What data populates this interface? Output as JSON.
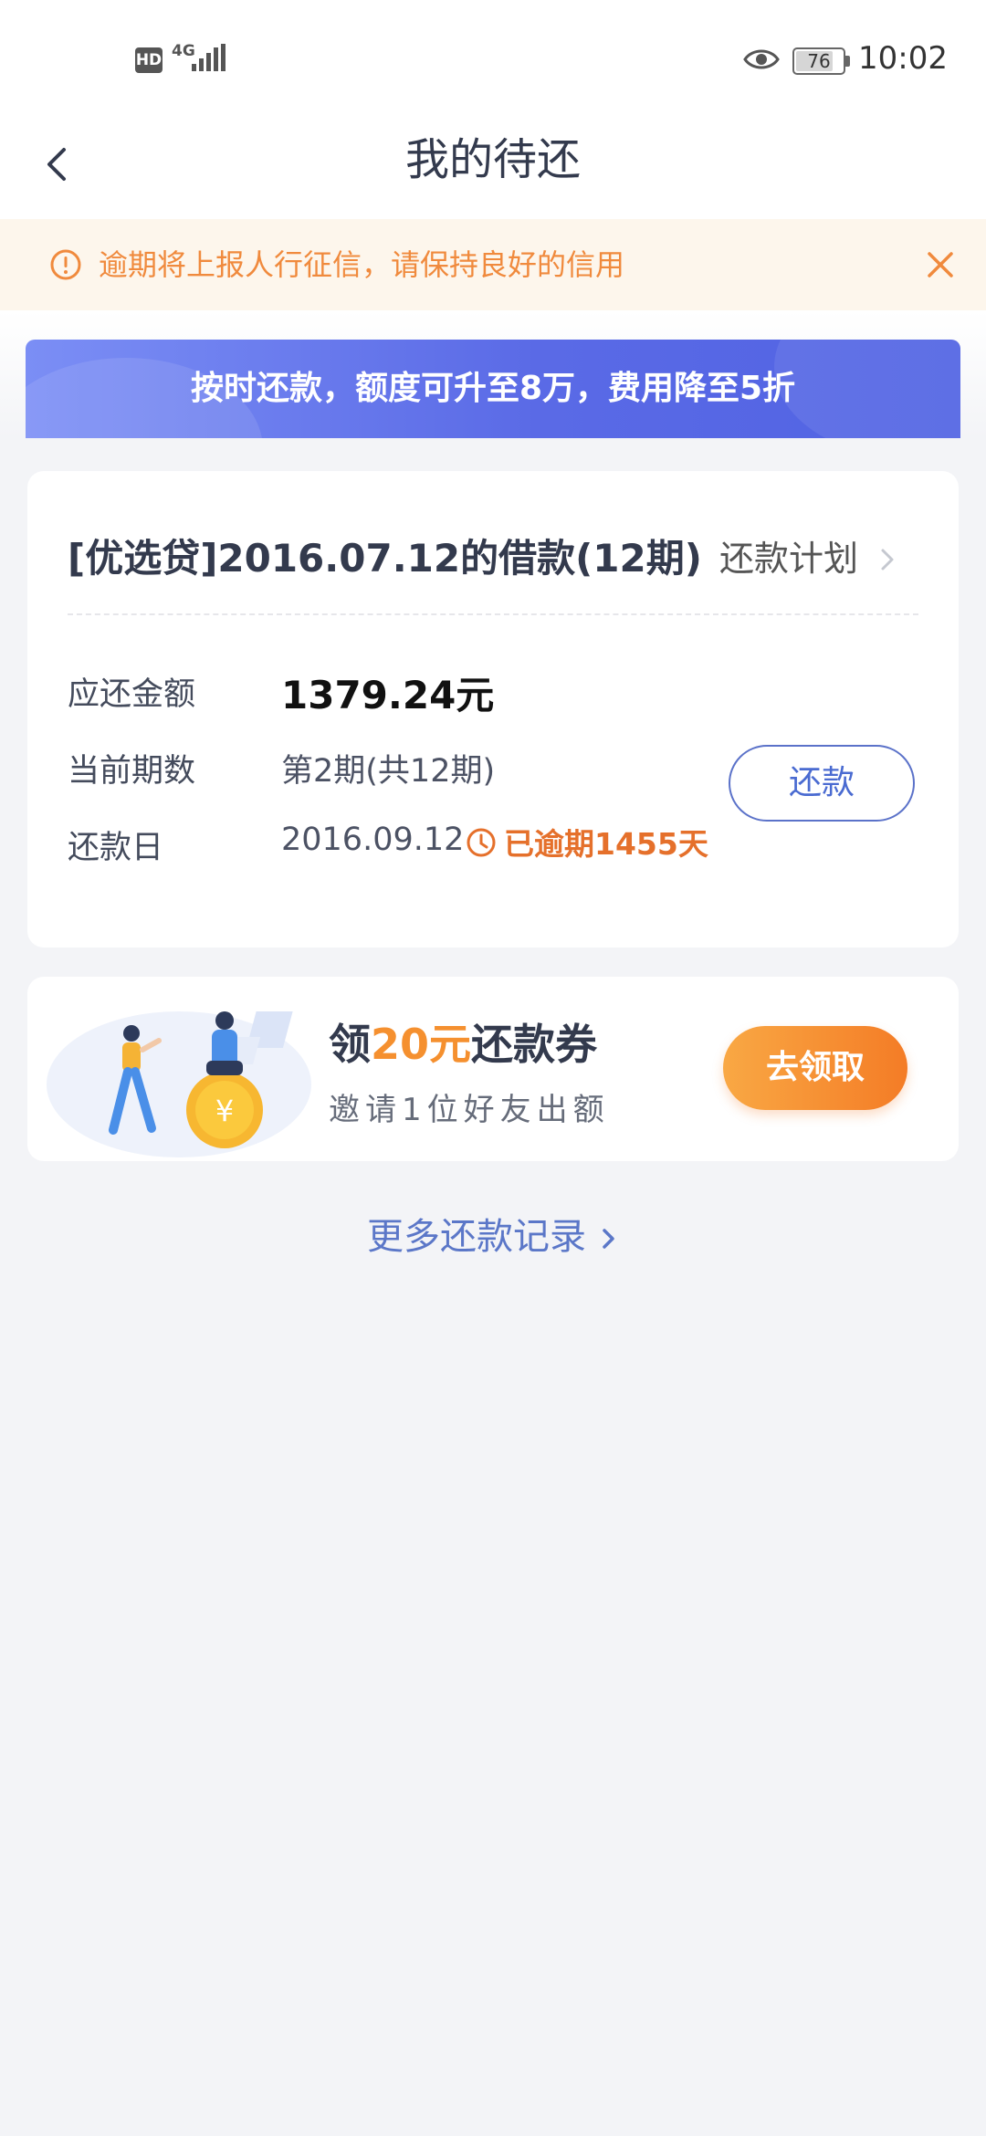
{
  "status_bar": {
    "hd_label": "HD",
    "network": "4G",
    "battery": "76",
    "time": "10:02",
    "icons": [
      "hd-icon",
      "signal-icon",
      "eye-icon",
      "battery-icon"
    ]
  },
  "header": {
    "title": "我的待还",
    "back_icon": "chevron-left-icon"
  },
  "notice": {
    "text": "逾期将上报人行征信，请保持良好的信用",
    "icon": "alert-circle-icon",
    "close_icon": "close-icon"
  },
  "promo": {
    "text": "按时还款，额度可升至8万，费用降至5折"
  },
  "loan": {
    "title": "[优选贷]2016.07.12的借款(12期)",
    "plan_label": "还款计划",
    "amount_label": "应还金额",
    "amount_value": "1379.24元",
    "period_label": "当前期数",
    "period_value": "第2期(共12期)",
    "due_label": "还款日",
    "due_value": "2016.09.12",
    "overdue_text": "已逾期1455天",
    "repay_button": "还款"
  },
  "coupon": {
    "title_prefix": "领",
    "title_highlight": "20元",
    "title_suffix": "还款券",
    "subtitle": "邀请1位好友出额",
    "button": "去领取"
  },
  "more_records": {
    "label": "更多还款记录"
  },
  "colors": {
    "accent_blue": "#5b72c9",
    "warning_orange": "#f08a3d",
    "overdue_orange": "#e5702b",
    "promo_blue": "#5a6ae6",
    "coupon_orange": "#f47c26"
  }
}
